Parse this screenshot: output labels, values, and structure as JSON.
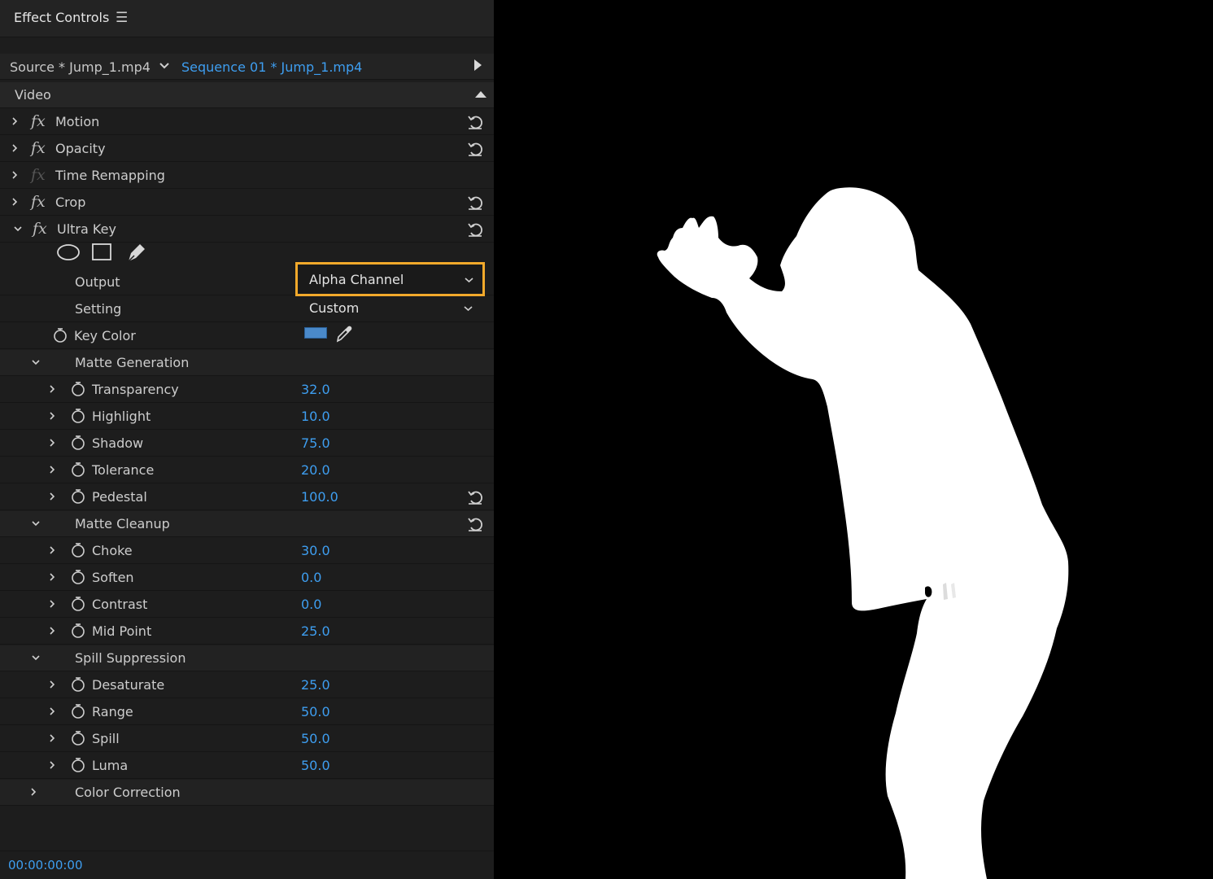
{
  "panel": {
    "title": "Effect Controls",
    "menu_icon": "hamburger-icon",
    "source_clip": "Source * Jump_1.mp4",
    "sequence_clip": "Sequence 01 * Jump_1.mp4",
    "video_section": "Video"
  },
  "effects": [
    {
      "name": "Motion"
    },
    {
      "name": "Opacity"
    },
    {
      "name": "Time Remapping"
    },
    {
      "name": "Crop"
    },
    {
      "name": "Ultra Key"
    }
  ],
  "ultra_key": {
    "output_label": "Output",
    "output_value": "Alpha Channel",
    "setting_label": "Setting",
    "setting_value": "Custom",
    "key_color_label": "Key Color",
    "key_color": "#4a89c9",
    "matte_generation": {
      "label": "Matte Generation",
      "params": [
        {
          "name": "Transparency",
          "value": "32.0"
        },
        {
          "name": "Highlight",
          "value": "10.0"
        },
        {
          "name": "Shadow",
          "value": "75.0"
        },
        {
          "name": "Tolerance",
          "value": "20.0"
        },
        {
          "name": "Pedestal",
          "value": "100.0"
        }
      ]
    },
    "matte_cleanup": {
      "label": "Matte Cleanup",
      "params": [
        {
          "name": "Choke",
          "value": "30.0"
        },
        {
          "name": "Soften",
          "value": "0.0"
        },
        {
          "name": "Contrast",
          "value": "0.0"
        },
        {
          "name": "Mid Point",
          "value": "25.0"
        }
      ]
    },
    "spill_suppression": {
      "label": "Spill Suppression",
      "params": [
        {
          "name": "Desaturate",
          "value": "25.0"
        },
        {
          "name": "Range",
          "value": "50.0"
        },
        {
          "name": "Spill",
          "value": "50.0"
        },
        {
          "name": "Luma",
          "value": "50.0"
        }
      ]
    },
    "color_correction_label": "Color Correction"
  },
  "timecode": "00:00:00:00",
  "colors": {
    "accent_blue": "#3e9ef0",
    "highlight_orange": "#f2a92b",
    "panel_bg": "#1d1d1d"
  }
}
